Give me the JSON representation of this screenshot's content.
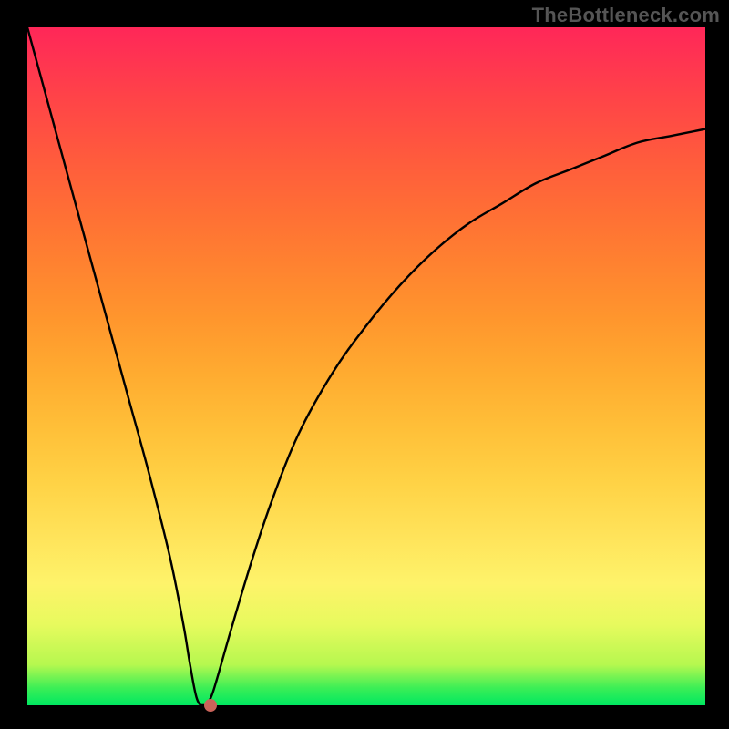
{
  "watermark": "TheBottleneck.com",
  "chart_data": {
    "type": "line",
    "title": "",
    "xlabel": "",
    "ylabel": "",
    "xlim": [
      0,
      100
    ],
    "ylim": [
      0,
      100
    ],
    "grid": false,
    "legend": false,
    "series": [
      {
        "name": "curve",
        "x": [
          0,
          3,
          6,
          9,
          12,
          15,
          18,
          21,
          23,
          24,
          25,
          26,
          27,
          28,
          30,
          33,
          36,
          40,
          45,
          50,
          55,
          60,
          65,
          70,
          75,
          80,
          85,
          90,
          95,
          100
        ],
        "y": [
          100,
          89,
          78,
          67,
          56,
          45,
          34,
          22,
          12,
          6,
          1,
          0,
          1,
          4,
          11,
          21,
          30,
          40,
          49,
          56,
          62,
          67,
          71,
          74,
          77,
          79,
          81,
          83,
          84,
          85
        ]
      }
    ],
    "marker": {
      "x": 27,
      "y": 0,
      "color": "#c9635a"
    },
    "background_gradient_top": "#ff2758",
    "background_gradient_bottom": "#00e861"
  }
}
